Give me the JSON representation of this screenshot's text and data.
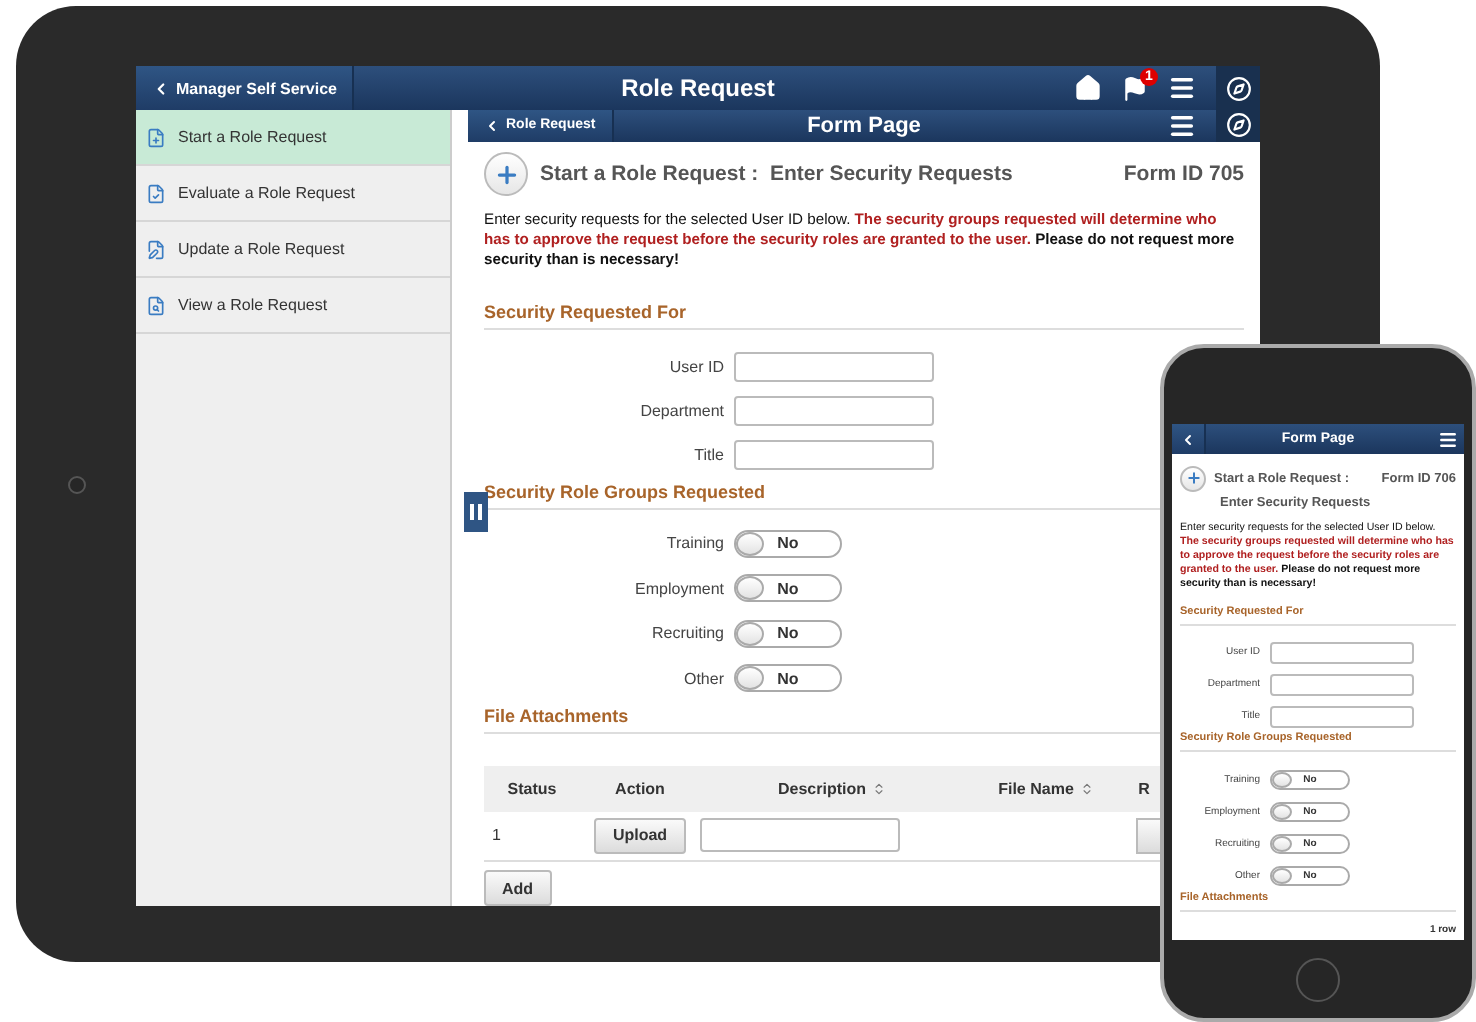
{
  "tablet": {
    "header": {
      "back_label": "Manager Self Service",
      "title": "Role Request",
      "alert_count": "1"
    },
    "sidebar": {
      "items": [
        {
          "label": "Start a Role Request",
          "selected": true
        },
        {
          "label": "Evaluate a Role Request",
          "selected": false
        },
        {
          "label": "Update a Role Request",
          "selected": false
        },
        {
          "label": "View a Role Request",
          "selected": false
        }
      ]
    },
    "form": {
      "back_label": "Role Request",
      "title": "Form Page",
      "heading": "Start a Role Request :  Enter Security Requests",
      "form_id": "Form ID 705",
      "intro": [
        {
          "kind": "plain",
          "text": "Enter security requests for the selected User ID below. "
        },
        {
          "kind": "warning",
          "text": "The security groups requested will determine who has to approve the request before the security roles are granted to the user."
        },
        {
          "kind": "strong",
          "text": " Please do not request more security than is necessary!"
        }
      ],
      "fields_title": "Security Requested For",
      "fields": [
        {
          "label": "User ID"
        },
        {
          "label": "Department"
        },
        {
          "label": "Title"
        }
      ],
      "toggles_title": "Security Role Groups Requested",
      "toggles": [
        {
          "label": "Training",
          "value": "No",
          "on": false
        },
        {
          "label": "Employment",
          "value": "No",
          "on": false
        },
        {
          "label": "Recruiting",
          "value": "No",
          "on": false
        },
        {
          "label": "Other",
          "value": "No",
          "on": false
        }
      ],
      "attachments_title": "File Attachments",
      "columns": [
        {
          "label": "Status",
          "sortable": false
        },
        {
          "label": "Action",
          "sortable": false
        },
        {
          "label": "Description",
          "sortable": true
        },
        {
          "label": "File Name",
          "sortable": true
        },
        {
          "label": "R",
          "sortable": false
        }
      ],
      "rows": [
        {
          "status": "1",
          "action": "Upload"
        }
      ],
      "add_label": "Add"
    }
  },
  "phone": {
    "header": {
      "title": "Form Page"
    },
    "form": {
      "heading": "Start a Role Request :",
      "form_id": "Form ID 706",
      "subheading": "Enter Security Requests",
      "intro": [
        {
          "kind": "plain",
          "text": "Enter security requests for the selected User ID below. "
        },
        {
          "kind": "warning",
          "text": "The security groups requested will determine who has to approve the request before the security roles are granted to the user."
        },
        {
          "kind": "strong",
          "text": " Please do not request more security than is necessary!"
        }
      ],
      "fields_title": "Security Requested For",
      "fields": [
        {
          "label": "User ID"
        },
        {
          "label": "Department"
        },
        {
          "label": "Title"
        }
      ],
      "toggles_title": "Security Role Groups Requested",
      "toggles": [
        {
          "label": "Training",
          "value": "No",
          "on": false
        },
        {
          "label": "Employment",
          "value": "No",
          "on": false
        },
        {
          "label": "Recruiting",
          "value": "No",
          "on": false
        },
        {
          "label": "Other",
          "value": "No",
          "on": false
        }
      ],
      "attachments_title": "File Attachments",
      "row_count": "1 row"
    }
  }
}
